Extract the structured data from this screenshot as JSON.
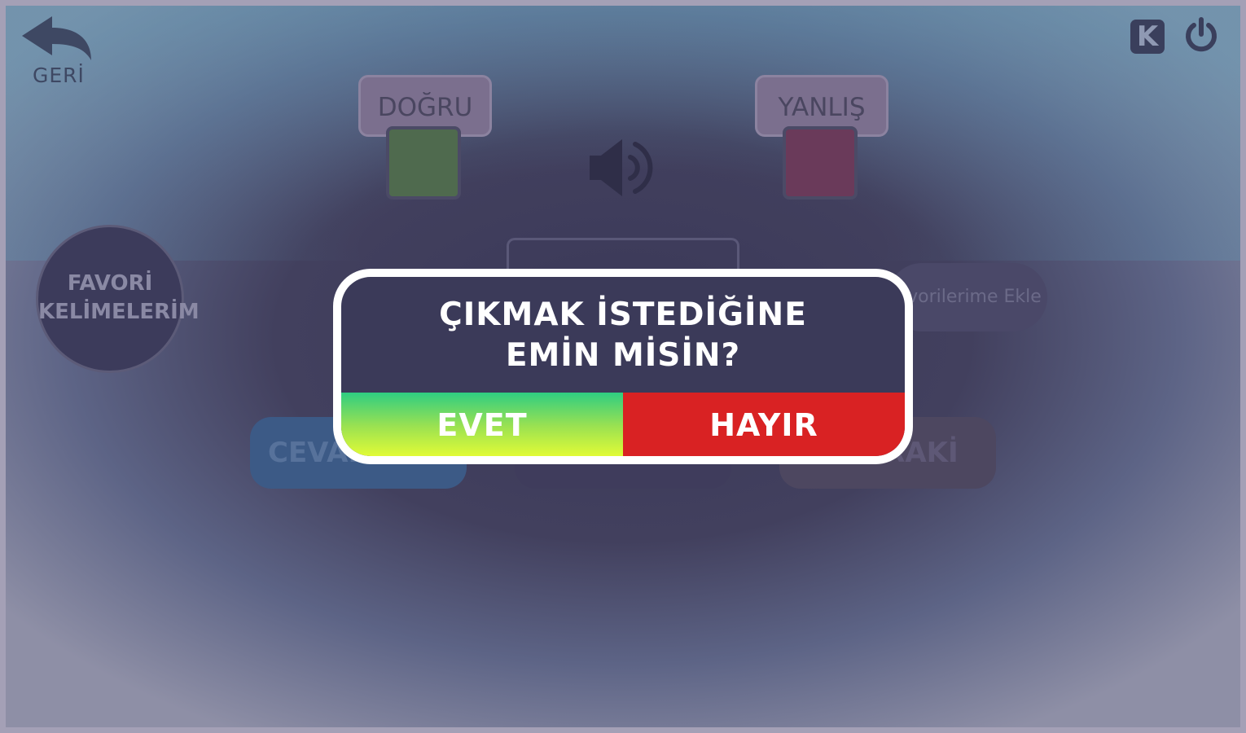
{
  "header": {
    "back_label": "GERİ",
    "k_label": "K",
    "icons": {
      "back": "back-arrow-icon",
      "power": "power-icon",
      "k": "k-logo-icon"
    }
  },
  "game": {
    "correct_label": "DOĞRU",
    "wrong_label": "YANLIŞ",
    "correct_color": "#4f6a4e",
    "wrong_color": "#6a3a5a",
    "speaker_icon": "speaker-icon",
    "add_favorites_label": "Favorilerime Ekle"
  },
  "favorites": {
    "line1": "FAVORİ",
    "line2": "KELİMELERİM"
  },
  "bottom_buttons": {
    "left_label": "CEVAP",
    "right_label": "SONRAKİ",
    "left_color": "#3c5a86",
    "right_color": "#4d4760"
  },
  "dialog": {
    "title_line1": "ÇIKMAK İSTEDİĞİNE",
    "title_line2": "EMİN MİSİN?",
    "yes_label": "EVET",
    "no_label": "HAYIR",
    "no_color": "#d92223"
  }
}
